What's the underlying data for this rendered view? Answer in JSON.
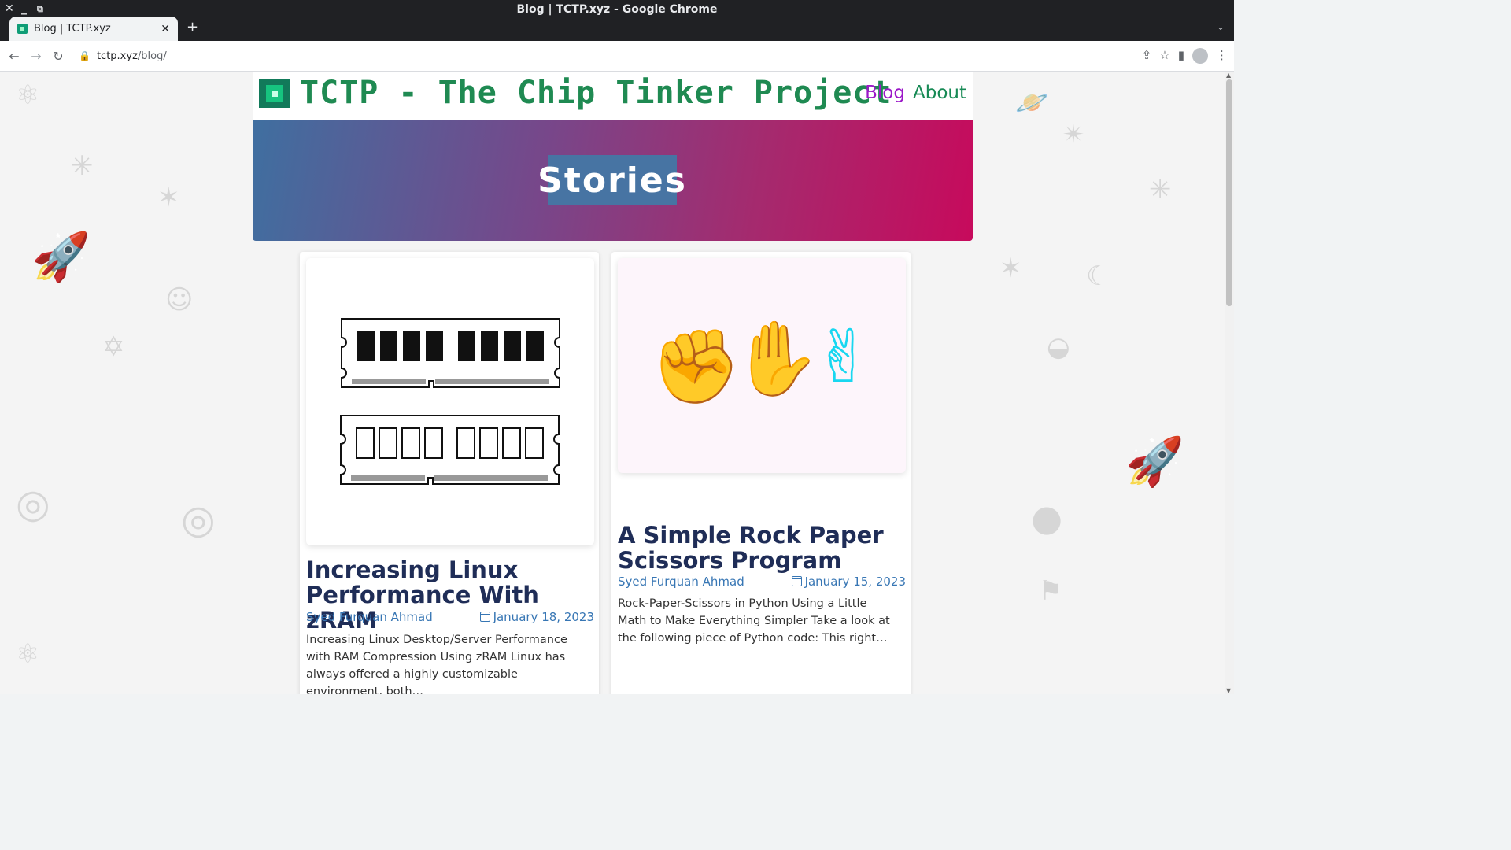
{
  "window": {
    "title": "Blog | TCTP.xyz - Google Chrome"
  },
  "tab": {
    "title": "Blog | TCTP.xyz",
    "close": "✕",
    "new_tab": "+"
  },
  "omnibox": {
    "domain": "tctp.xyz",
    "path": "/blog/"
  },
  "site": {
    "title": "TCTP - The Chip Tinker Project",
    "nav": {
      "blog": "Blog",
      "about": "About"
    }
  },
  "hero": {
    "title": "Stories"
  },
  "posts": [
    {
      "title": "Increasing Linux Performance With zRAM",
      "author": "Syed Furquan Ahmad",
      "date": "January 18, 2023",
      "excerpt": "Increasing Linux Desktop/Server Performance with RAM Compression Using zRAM Linux has always offered a highly customizable environment, both…"
    },
    {
      "title": "A Simple Rock Paper Scissors Program",
      "author": "Syed Furquan Ahmad",
      "date": "January 15, 2023",
      "excerpt": "Rock-Paper-Scissors in Python Using a Little Math to Make Everything Simpler Take a look at the following piece of Python code: This right…"
    }
  ],
  "icons": {
    "rock": "✊",
    "paper": "✋",
    "scissors": "✌"
  }
}
